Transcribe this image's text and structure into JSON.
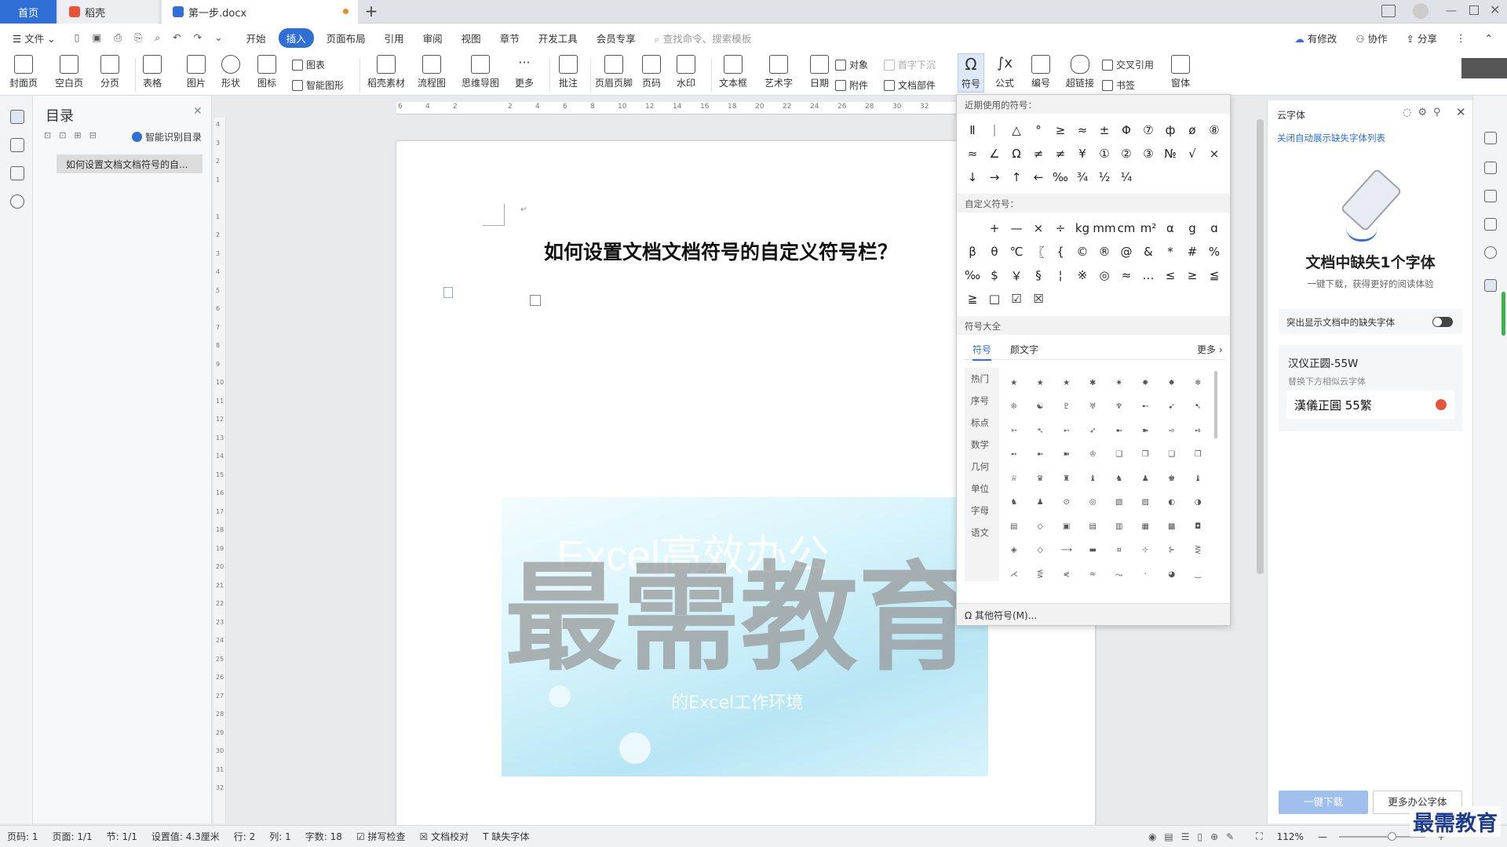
{
  "tabs": {
    "home": "首页",
    "daoke": "稻壳",
    "doc": "第一步.docx"
  },
  "menu": {
    "file": "文件",
    "items": [
      "开始",
      "插入",
      "页面布局",
      "引用",
      "审阅",
      "视图",
      "章节",
      "开发工具",
      "会员专享"
    ],
    "active": "插入",
    "search": "查找命令、搜索模板",
    "right": [
      "有修改",
      "协作",
      "分享"
    ]
  },
  "ribbon": {
    "cover": "封面页",
    "blank": "空白页",
    "pagebreak": "分页",
    "table": "表格",
    "picture": "图片",
    "shape": "形状",
    "icon": "图标",
    "chart": "图表",
    "smartart": "智能图形",
    "daoke": "稻壳素材",
    "flow": "流程图",
    "mind": "思维导图",
    "more": "更多",
    "comment": "批注",
    "header": "页眉页脚",
    "pageno": "页码",
    "watermark": "水印",
    "textbox": "文本框",
    "wordart": "艺术字",
    "date": "日期",
    "object": "对象",
    "attach": "附件",
    "dropcap": "首字下沉",
    "docpart": "文档部件",
    "symbol": "符号",
    "formula": "公式",
    "number": "编号",
    "hyperlink": "超链接",
    "crossref": "交叉引用",
    "bookmark": "书签",
    "window": "窗体"
  },
  "toc": {
    "title": "目录",
    "smart": "智能识别目录",
    "item": "如何设置文档文档符号的自..."
  },
  "ruler": {
    "h": [
      "6",
      "4",
      "2",
      "",
      "2",
      "4",
      "6",
      "8",
      "10",
      "12",
      "14",
      "16",
      "18",
      "20",
      "22",
      "24",
      "26",
      "28",
      "30",
      "32"
    ],
    "v": [
      "4",
      "3",
      "2",
      "1",
      "",
      "1",
      "2",
      "3",
      "4",
      "5",
      "6",
      "7",
      "8",
      "9",
      "10",
      "11",
      "12",
      "13",
      "14",
      "15",
      "16",
      "17",
      "18",
      "19",
      "20",
      "21",
      "22",
      "23",
      "24",
      "25",
      "26",
      "27",
      "28",
      "29",
      "30",
      "31",
      "32"
    ]
  },
  "document": {
    "heading": "如何设置文档文档符号的自定义符号栏？",
    "watermark_big": "最需教育",
    "watermark_top": "Excel高效办公",
    "watermark_sub": "的Excel工作环境"
  },
  "symbols": {
    "recent_title": "近期使用的符号：",
    "recent": [
      "Ⅱ",
      "｜",
      "△",
      "°",
      "≥",
      "≈",
      "±",
      "Φ",
      "⑦",
      "ф",
      "ø",
      "⑧",
      "≈",
      "∠",
      "Ω",
      "≠",
      "≠",
      "¥",
      "①",
      "②",
      "③",
      "№",
      "√",
      "×",
      "↓",
      "→",
      "↑",
      "←",
      "‰",
      "¾",
      "½",
      "¼"
    ],
    "custom_title": "自定义符号：",
    "custom": [
      "",
      "+",
      "—",
      "×",
      "÷",
      "kg",
      "mm",
      "cm",
      "m²",
      "α",
      "g",
      "ɑ",
      "β",
      "θ",
      "℃",
      "〖",
      "{",
      "©",
      "®",
      "@",
      "&",
      "*",
      "#",
      "%",
      "‰",
      "$",
      "￥",
      "§",
      "¦",
      "※",
      "◎",
      "≈",
      "…",
      "≤",
      "≥",
      "≦",
      "≧",
      "□",
      "☑",
      "☒"
    ],
    "all_title": "符号大全",
    "tab_symbol": "符号",
    "tab_kaomoji": "颜文字",
    "more": "更多",
    "categories": [
      "热门",
      "序号",
      "标点",
      "数学",
      "几何",
      "单位",
      "字母",
      "语文"
    ],
    "grid": [
      "★",
      "★",
      "★",
      "✱",
      "✷",
      "✸",
      "✹",
      "❄",
      "❊",
      "☯",
      "♇",
      "♅",
      "♆",
      "➸",
      "➹",
      "➷",
      "➳",
      "➴",
      "➵",
      "➶",
      "➼",
      "➽",
      "➾",
      "➺",
      "➻",
      "➼",
      "➽",
      "♔",
      "❑",
      "❒",
      "❏",
      "❐",
      "♕",
      "♛",
      "♜",
      "♝",
      "♞",
      "♟",
      "♚",
      "♝",
      "♞",
      "♟",
      "⊙",
      "◎",
      "▧",
      "▨",
      "◐",
      "◑",
      "▤",
      "◇",
      "▣",
      "▤",
      "▥",
      "▦",
      "▩",
      "◘",
      "◈",
      "◇",
      "⟶",
      "▬",
      "¤",
      "⊹",
      "⊱",
      "⋛",
      "⋌",
      "⋚",
      "⋞",
      "≈",
      "～",
      "·",
      "◕",
      "‿"
    ],
    "other": "其他符号(M)..."
  },
  "panel": {
    "title": "云字体",
    "close_text": "关闭自动展示缺失字体列表",
    "headline": "文档中缺失1个字体",
    "sub": "一键下载，获得更好的阅读体验",
    "toggle": "突出显示文档中的缺失字体",
    "font_name": "汉仪正圆-55W",
    "replace": "替换下方相似云字体",
    "font_sample": "漢儀正圓 55繁",
    "download": "一键下载",
    "more_fonts": "更多办公字体"
  },
  "status": {
    "page": "页码: 1",
    "pages": "页面: 1/1",
    "section": "节: 1/1",
    "setting": "设置值: 4.3厘米",
    "row": "行: 2",
    "col": "列: 1",
    "words": "字数: 18",
    "spell": "拼写检查",
    "check": "文档校对",
    "missing": "缺失字体",
    "zoom": "112%"
  },
  "logo": "最需教育",
  "colors": {
    "accent": "#2f6fd6",
    "panel_blue": "#2f6fd6",
    "wm_gray": "#b0b0b0"
  }
}
